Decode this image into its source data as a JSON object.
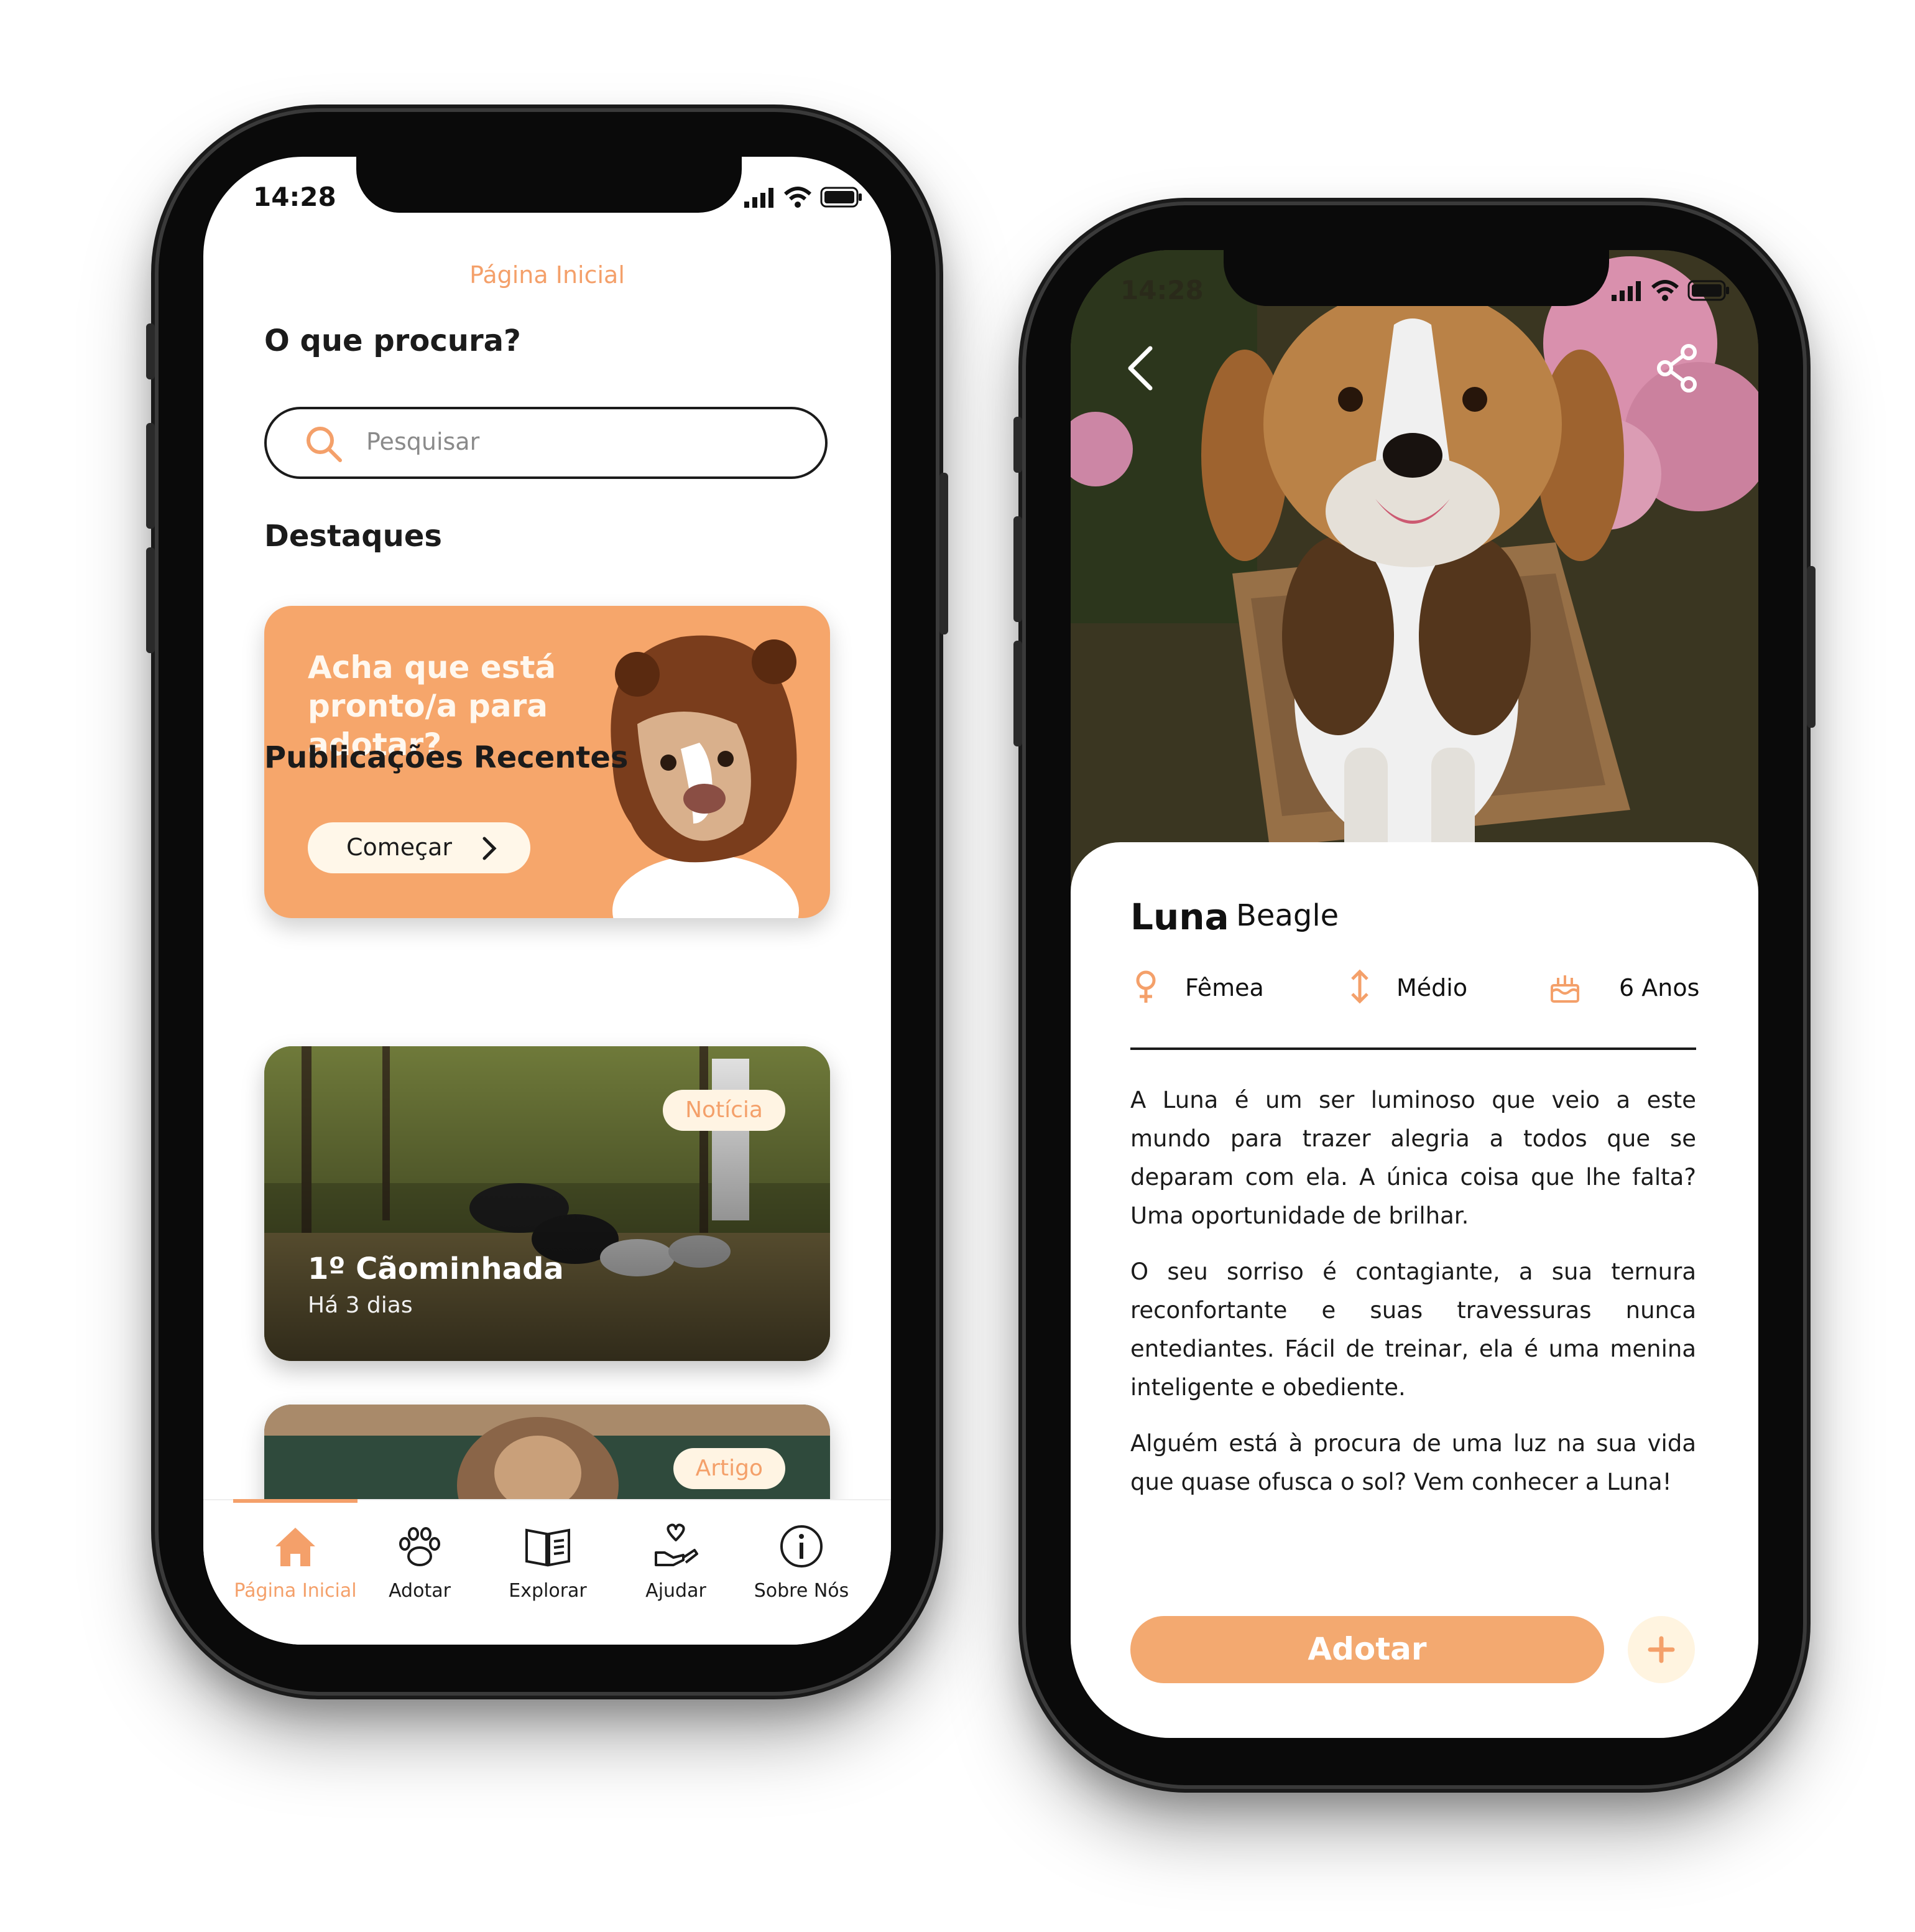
{
  "home": {
    "status_time": "14:28",
    "page_title": "Página Inicial",
    "search_heading": "O que procura?",
    "search_placeholder": "Pesquisar",
    "highlights_heading": "Destaques",
    "featured": {
      "text": "Acha que está pronto/a para adotar?",
      "button_label": "Começar"
    },
    "recent_heading": "Publicações Recentes",
    "posts": [
      {
        "tag": "Notícia",
        "title": "1º Cãominhada",
        "subtitle": "Há 3 dias"
      },
      {
        "tag": "Artigo"
      }
    ],
    "tabs": [
      {
        "label": "Página Inicial",
        "icon": "home-icon",
        "active": true
      },
      {
        "label": "Adotar",
        "icon": "paw-icon"
      },
      {
        "label": "Explorar",
        "icon": "book-icon"
      },
      {
        "label": "Ajudar",
        "icon": "heart-hand-icon"
      },
      {
        "label": "Sobre Nós",
        "icon": "info-icon"
      }
    ]
  },
  "detail": {
    "status_time": "14:28",
    "name": "Luna",
    "breed": "Beagle",
    "attributes": [
      {
        "label": "Fêmea",
        "icon": "female-icon"
      },
      {
        "label": "Médio",
        "icon": "size-arrows-icon"
      },
      {
        "label": "6 Anos",
        "icon": "cake-icon"
      }
    ],
    "description": [
      "A Luna é um ser luminoso que veio a este mundo para trazer alegria a todos que se deparam com ela. A única coisa que lhe falta? Uma oportunidade de brilhar.",
      "O seu sorriso é contagiante, a sua ternura reconfortante e suas travessuras nunca entediantes. Fácil de treinar, ela é uma menina inteligente e obediente.",
      "Alguém está à procura de uma luz na sua vida que quase ofusca o sol? Vem conhecer a Luna!"
    ],
    "adopt_label": "Adotar",
    "plus_label": "+"
  },
  "colors": {
    "accent": "#f4a06a",
    "cream": "#fff4e3",
    "text": "#1b1b1b"
  }
}
